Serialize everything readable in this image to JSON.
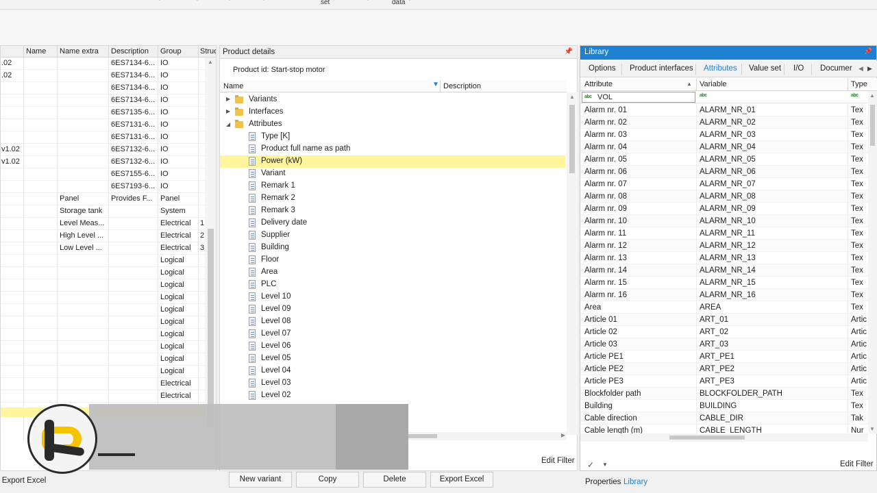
{
  "ribbon": {
    "label_set": "set",
    "label_data": "data"
  },
  "left_grid": {
    "columns": [
      "Name",
      "Name extra",
      "Description",
      "Group",
      "Struc"
    ],
    "rows": [
      {
        "c0": ".02",
        "c1": "",
        "c2": "",
        "c3": "6ES7134-6...",
        "c4": "IO",
        "c5": ""
      },
      {
        "c0": ".02",
        "c1": "",
        "c2": "",
        "c3": "6ES7134-6...",
        "c4": "IO",
        "c5": ""
      },
      {
        "c0": "",
        "c1": "",
        "c2": "",
        "c3": "6ES7134-6...",
        "c4": "IO",
        "c5": ""
      },
      {
        "c0": "",
        "c1": "",
        "c2": "",
        "c3": "6ES7134-6...",
        "c4": "IO",
        "c5": ""
      },
      {
        "c0": "",
        "c1": "",
        "c2": "",
        "c3": "6ES7135-6...",
        "c4": "IO",
        "c5": ""
      },
      {
        "c0": "",
        "c1": "",
        "c2": "",
        "c3": "6ES7131-6...",
        "c4": "IO",
        "c5": ""
      },
      {
        "c0": "",
        "c1": "",
        "c2": "",
        "c3": "6ES7131-6...",
        "c4": "IO",
        "c5": ""
      },
      {
        "c0": "v1.02",
        "c1": "",
        "c2": "",
        "c3": "6ES7132-6...",
        "c4": "IO",
        "c5": ""
      },
      {
        "c0": "v1.02",
        "c1": "",
        "c2": "",
        "c3": "6ES7132-6...",
        "c4": "IO",
        "c5": ""
      },
      {
        "c0": "",
        "c1": "",
        "c2": "",
        "c3": "6ES7155-6...",
        "c4": "IO",
        "c5": ""
      },
      {
        "c0": "",
        "c1": "",
        "c2": "",
        "c3": "6ES7193-6...",
        "c4": "IO",
        "c5": ""
      },
      {
        "c0": "",
        "c1": "",
        "c2": "Panel",
        "c3": "Provides F...",
        "c4": "Panel",
        "c5": ""
      },
      {
        "c0": "",
        "c1": "",
        "c2": "Storage tank",
        "c3": "",
        "c4": "System",
        "c5": ""
      },
      {
        "c0": "",
        "c1": "",
        "c2": "Level Meas...",
        "c3": "",
        "c4": "Electrical",
        "c5": "1"
      },
      {
        "c0": "",
        "c1": "",
        "c2": "High Level ...",
        "c3": "",
        "c4": "Electrical",
        "c5": "2"
      },
      {
        "c0": "",
        "c1": "",
        "c2": "Low Level ...",
        "c3": "",
        "c4": "Electrical",
        "c5": "3"
      },
      {
        "c0": "",
        "c1": "",
        "c2": "",
        "c3": "",
        "c4": "Logical",
        "c5": ""
      },
      {
        "c0": "",
        "c1": "",
        "c2": "",
        "c3": "",
        "c4": "Logical",
        "c5": ""
      },
      {
        "c0": "",
        "c1": "",
        "c2": "",
        "c3": "",
        "c4": "Logical",
        "c5": ""
      },
      {
        "c0": "",
        "c1": "",
        "c2": "",
        "c3": "",
        "c4": "Logical",
        "c5": ""
      },
      {
        "c0": "",
        "c1": "",
        "c2": "",
        "c3": "",
        "c4": "Logical",
        "c5": ""
      },
      {
        "c0": "",
        "c1": "",
        "c2": "",
        "c3": "",
        "c4": "Logical",
        "c5": ""
      },
      {
        "c0": "",
        "c1": "",
        "c2": "",
        "c3": "",
        "c4": "Logical",
        "c5": ""
      },
      {
        "c0": "",
        "c1": "",
        "c2": "",
        "c3": "",
        "c4": "Logical",
        "c5": ""
      },
      {
        "c0": "",
        "c1": "",
        "c2": "",
        "c3": "",
        "c4": "Logical",
        "c5": ""
      },
      {
        "c0": "",
        "c1": "",
        "c2": "",
        "c3": "",
        "c4": "Logical",
        "c5": ""
      },
      {
        "c0": "",
        "c1": "",
        "c2": "",
        "c3": "",
        "c4": "Electrical",
        "c5": ""
      },
      {
        "c0": "",
        "c1": "",
        "c2": "",
        "c3": "",
        "c4": "Electrical",
        "c5": ""
      }
    ],
    "export_label": "Export Excel"
  },
  "product_details": {
    "title": "Product details",
    "product_id": "Product id: Start-stop motor",
    "col_name": "Name",
    "col_description": "Description",
    "tree": [
      {
        "label": "Variants",
        "type": "folder",
        "expander": "collapsed"
      },
      {
        "label": "Interfaces",
        "type": "folder",
        "expander": "collapsed"
      },
      {
        "label": "Attributes",
        "type": "folder",
        "expander": "expanded"
      },
      {
        "label": "Type [K]",
        "type": "item"
      },
      {
        "label": "Product full name as path",
        "type": "item"
      },
      {
        "label": "Power (kW)",
        "type": "item",
        "selected": true
      },
      {
        "label": "Variant",
        "type": "item"
      },
      {
        "label": "Remark 1",
        "type": "item"
      },
      {
        "label": "Remark 2",
        "type": "item"
      },
      {
        "label": "Remark 3",
        "type": "item"
      },
      {
        "label": "Delivery date",
        "type": "item"
      },
      {
        "label": "Supplier",
        "type": "item"
      },
      {
        "label": "Building",
        "type": "item"
      },
      {
        "label": "Floor",
        "type": "item"
      },
      {
        "label": "Area",
        "type": "item"
      },
      {
        "label": "PLC",
        "type": "item"
      },
      {
        "label": "Level 10",
        "type": "item"
      },
      {
        "label": "Level 09",
        "type": "item"
      },
      {
        "label": "Level 08",
        "type": "item"
      },
      {
        "label": "Level 07",
        "type": "item"
      },
      {
        "label": "Level 06",
        "type": "item"
      },
      {
        "label": "Level 05",
        "type": "item"
      },
      {
        "label": "Level 04",
        "type": "item"
      },
      {
        "label": "Level 03",
        "type": "item"
      },
      {
        "label": "Level 02",
        "type": "item"
      }
    ],
    "edit_filter": "Edit Filter",
    "buttons": {
      "new_variant": "New variant",
      "copy": "Copy",
      "delete": "Delete",
      "export_excel": "Export Excel"
    }
  },
  "library": {
    "title": "Library",
    "tabs": [
      "Options",
      "Product interfaces",
      "Attributes",
      "Value set",
      "I/O",
      "Documer"
    ],
    "active_tab": "Attributes",
    "columns": [
      "Attribute",
      "Variable",
      "Type"
    ],
    "filter_value": "VOL",
    "filter_abc": "abc",
    "rows": [
      {
        "a": "Alarm nr. 01",
        "v": "ALARM_NR_01",
        "t": "Tex"
      },
      {
        "a": "Alarm nr. 02",
        "v": "ALARM_NR_02",
        "t": "Tex"
      },
      {
        "a": "Alarm nr. 03",
        "v": "ALARM_NR_03",
        "t": "Tex"
      },
      {
        "a": "Alarm nr. 04",
        "v": "ALARM_NR_04",
        "t": "Tex"
      },
      {
        "a": "Alarm nr. 05",
        "v": "ALARM_NR_05",
        "t": "Tex"
      },
      {
        "a": "Alarm nr. 06",
        "v": "ALARM_NR_06",
        "t": "Tex"
      },
      {
        "a": "Alarm nr. 07",
        "v": "ALARM_NR_07",
        "t": "Tex"
      },
      {
        "a": "Alarm nr. 08",
        "v": "ALARM_NR_08",
        "t": "Tex"
      },
      {
        "a": "Alarm nr. 09",
        "v": "ALARM_NR_09",
        "t": "Tex"
      },
      {
        "a": "Alarm nr. 10",
        "v": "ALARM_NR_10",
        "t": "Tex"
      },
      {
        "a": "Alarm nr. 11",
        "v": "ALARM_NR_11",
        "t": "Tex"
      },
      {
        "a": "Alarm nr. 12",
        "v": "ALARM_NR_12",
        "t": "Tex"
      },
      {
        "a": "Alarm nr. 13",
        "v": "ALARM_NR_13",
        "t": "Tex"
      },
      {
        "a": "Alarm nr. 14",
        "v": "ALARM_NR_14",
        "t": "Tex"
      },
      {
        "a": "Alarm nr. 15",
        "v": "ALARM_NR_15",
        "t": "Tex"
      },
      {
        "a": "Alarm nr. 16",
        "v": "ALARM_NR_16",
        "t": "Tex"
      },
      {
        "a": "Area",
        "v": "AREA",
        "t": "Tex"
      },
      {
        "a": "Article 01",
        "v": "ART_01",
        "t": "Artic"
      },
      {
        "a": "Article 02",
        "v": "ART_02",
        "t": "Artic"
      },
      {
        "a": "Article 03",
        "v": "ART_03",
        "t": "Artic"
      },
      {
        "a": "Article PE1",
        "v": "ART_PE1",
        "t": "Artic"
      },
      {
        "a": "Article PE2",
        "v": "ART_PE2",
        "t": "Artic"
      },
      {
        "a": "Article PE3",
        "v": "ART_PE3",
        "t": "Artic"
      },
      {
        "a": "Blockfolder path",
        "v": "BLOCKFOLDER_PATH",
        "t": "Tex"
      },
      {
        "a": "Building",
        "v": "BUILDING",
        "t": "Tex"
      },
      {
        "a": "Cable direction",
        "v": "CABLE_DIR",
        "t": "Tak"
      },
      {
        "a": "Cable length (m)",
        "v": "CABLE_LENGTH",
        "t": "Nur"
      }
    ],
    "edit_filter": "Edit Filter",
    "bottom_tabs": [
      "Properties",
      "Library"
    ],
    "active_bottom_tab": "Library",
    "accent_color": "#1f7fd1"
  }
}
